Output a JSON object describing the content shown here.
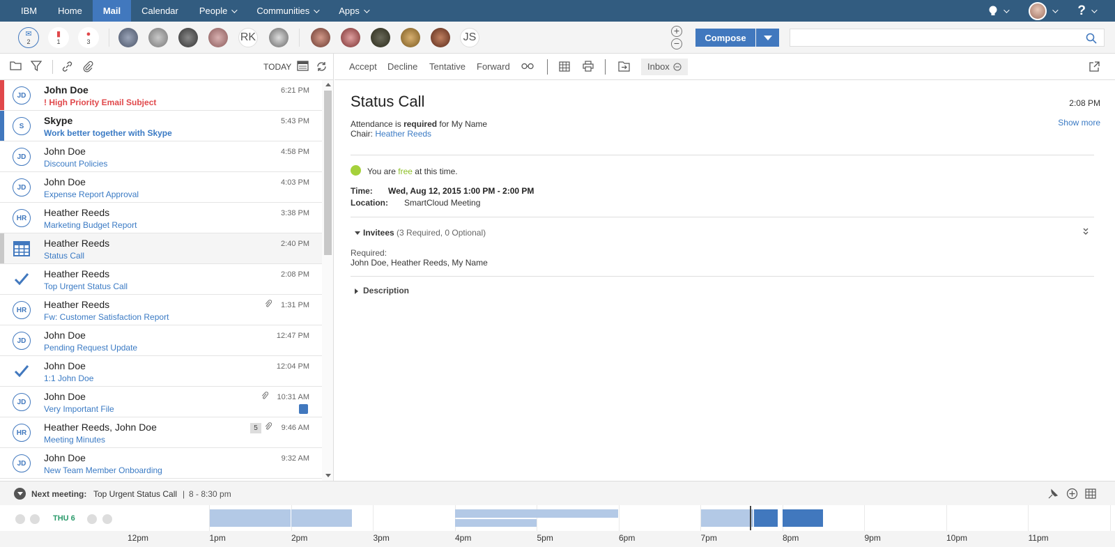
{
  "nav": {
    "items": [
      {
        "label": "IBM",
        "active": false,
        "dropdown": false
      },
      {
        "label": "Home",
        "active": false,
        "dropdown": false
      },
      {
        "label": "Mail",
        "active": true,
        "dropdown": false
      },
      {
        "label": "Calendar",
        "active": false,
        "dropdown": false
      },
      {
        "label": "People",
        "active": false,
        "dropdown": true
      },
      {
        "label": "Communities",
        "active": false,
        "dropdown": true
      },
      {
        "label": "Apps",
        "active": false,
        "dropdown": true
      }
    ],
    "help_glyph": "?"
  },
  "strip": {
    "badges": [
      {
        "name": "inbox-icon",
        "count": "2"
      },
      {
        "name": "flag-icon",
        "count": "1"
      },
      {
        "name": "alert-icon",
        "count": "3"
      }
    ],
    "initials": [
      "RK",
      "JS"
    ],
    "compose_label": "Compose"
  },
  "list_toolbar": {
    "today_label": "TODAY"
  },
  "messages": [
    {
      "sender": "John Doe",
      "subject": "! High Priority Email Subject",
      "time": "6:21 PM",
      "avatar": "JD",
      "marker": "#e0484b",
      "bold": true,
      "red": true
    },
    {
      "sender": "Skype",
      "subject": "Work better together with Skype",
      "time": "5:43 PM",
      "avatar": "S",
      "marker": "#4178be",
      "bold": true
    },
    {
      "sender": "John Doe",
      "subject": "Discount Policies",
      "time": "4:58 PM",
      "avatar": "JD"
    },
    {
      "sender": "John Doe",
      "subject": "Expense Report Approval",
      "time": "4:03 PM",
      "avatar": "JD"
    },
    {
      "sender": "Heather Reeds",
      "subject": "Marketing Budget Report",
      "time": "3:38 PM",
      "avatar": "HR"
    },
    {
      "sender": "Heather Reeds",
      "subject": "Status Call",
      "time": "2:40 PM",
      "avatar": "grid",
      "marker": "#c8c8c8",
      "selected": true
    },
    {
      "sender": "Heather Reeds",
      "subject": "Top Urgent Status Call",
      "time": "2:08 PM",
      "avatar": "check"
    },
    {
      "sender": "Heather Reeds",
      "subject": "Fw: Customer Satisfaction Report",
      "time": "1:31 PM",
      "avatar": "HR",
      "clip": true
    },
    {
      "sender": "John Doe",
      "subject": "Pending Request Update",
      "time": "12:47 PM",
      "avatar": "JD"
    },
    {
      "sender": "John Doe",
      "subject": "1:1 John Doe",
      "time": "12:04 PM",
      "avatar": "check"
    },
    {
      "sender": "John Doe",
      "subject": "Very Important File",
      "time": "10:31 AM",
      "avatar": "JD",
      "clip": true,
      "task": true
    },
    {
      "sender": "Heather Reeds, John Doe",
      "subject": "Meeting Minutes",
      "time": "9:46 AM",
      "avatar": "HR",
      "clip": true,
      "count": "5"
    },
    {
      "sender": "John Doe",
      "subject": "New Team Member Onboarding",
      "time": "9:32 AM",
      "avatar": "JD"
    }
  ],
  "read_toolbar": {
    "accept": "Accept",
    "decline": "Decline",
    "tentative": "Tentative",
    "forward": "Forward",
    "inbox": "Inbox"
  },
  "mail": {
    "title": "Status Call",
    "time": "2:08 PM",
    "show_more": "Show more",
    "attendance_pre": "Attendance is ",
    "attendance_req": "required",
    "attendance_post": " for My Name",
    "chair_label": "Chair: ",
    "chair_name": "Heather Reeds",
    "free_pre": "You are ",
    "free_word": "free",
    "free_post": " at this time.",
    "time_label": "Time:",
    "time_value": "Wed, Aug 12, 2015 1:00 PM - 2:00 PM",
    "location_label": "Location:",
    "location_value": "SmartCloud Meeting",
    "invitees_label": "Invitees",
    "invitees_count": " (3 Required, 0 Optional)",
    "required_label": "Required:",
    "required_names": "John Doe, Heather Reeds, My Name",
    "description_label": "Description"
  },
  "next_meeting": {
    "label": "Next meeting:",
    "title": "Top Urgent Status Call",
    "sep": "|",
    "time": "8 - 8:30 pm"
  },
  "timeline": {
    "day": "THU 6",
    "hours": [
      "12pm",
      "1pm",
      "2pm",
      "3pm",
      "4pm",
      "5pm",
      "6pm",
      "7pm",
      "8pm",
      "9pm",
      "10pm",
      "11pm"
    ],
    "current_time": 19.6,
    "events": [
      {
        "start": 13.0,
        "end": 14.0,
        "row": 0,
        "color": "#b3c9e6"
      },
      {
        "start": 14.0,
        "end": 14.75,
        "row": 0,
        "color": "#b3c9e6"
      },
      {
        "start": 16.0,
        "end": 18.0,
        "row": 0,
        "short": true,
        "color": "#b3c9e6"
      },
      {
        "start": 16.0,
        "end": 17.0,
        "row": 1,
        "color": "#b3c9e6"
      },
      {
        "start": 19.0,
        "end": 19.65,
        "row": 0,
        "color": "#b3c9e6"
      },
      {
        "start": 19.65,
        "end": 19.95,
        "row": 0,
        "color": "#4178be"
      },
      {
        "start": 20.0,
        "end": 20.5,
        "row": 0,
        "color": "#4178be"
      }
    ]
  }
}
